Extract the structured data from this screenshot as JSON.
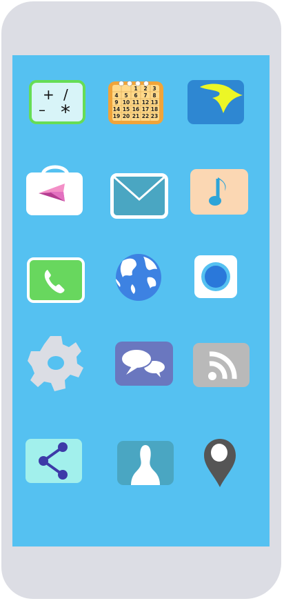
{
  "calendar": {
    "numbers": [
      [
        "",
        "",
        "1",
        "2",
        "3"
      ],
      [
        "4",
        "5",
        "6",
        "7",
        "8"
      ],
      [
        "9",
        "10",
        "11",
        "12",
        "13"
      ],
      [
        "14",
        "15",
        "16",
        "17",
        "18"
      ],
      [
        "19",
        "20",
        "21",
        "22",
        "23"
      ]
    ]
  },
  "calculator": {
    "symbols": [
      "+",
      "/",
      "–",
      "*"
    ]
  },
  "colors": {
    "phone_body": "#dcdde4",
    "screen": "#55c1f1"
  }
}
